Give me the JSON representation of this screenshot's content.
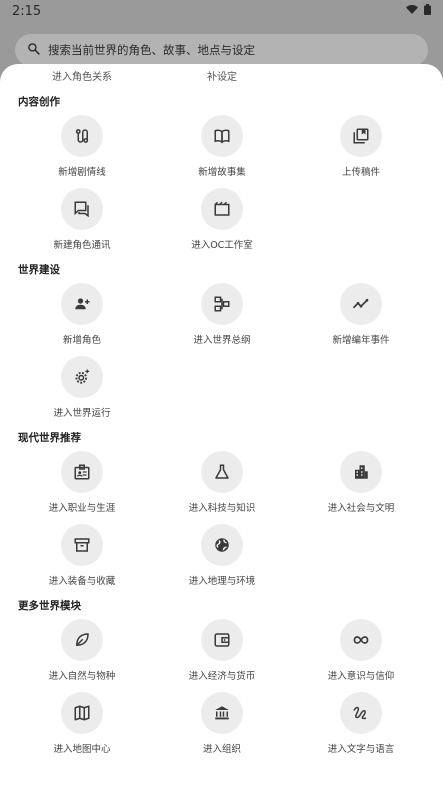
{
  "status": {
    "time": "2:15"
  },
  "search": {
    "placeholder": "搜索当前世界的角色、故事、地点与设定"
  },
  "top_partial": [
    "进入角色关系",
    "补设定"
  ],
  "sections": [
    {
      "title": "内容创作",
      "items": [
        {
          "label": "新增剧情线",
          "icon": "route-icon"
        },
        {
          "label": "新增故事集",
          "icon": "book-icon"
        },
        {
          "label": "上传稿件",
          "icon": "library-icon"
        },
        {
          "label": "新建角色通讯",
          "icon": "chat-icon"
        },
        {
          "label": "进入OC工作室",
          "icon": "clapperboard-icon"
        }
      ]
    },
    {
      "title": "世界建设",
      "items": [
        {
          "label": "新增角色",
          "icon": "person-add-icon"
        },
        {
          "label": "进入世界总纲",
          "icon": "hierarchy-icon"
        },
        {
          "label": "新增编年事件",
          "icon": "timeline-icon"
        },
        {
          "label": "进入世界运行",
          "icon": "settings-gear-icon"
        }
      ]
    },
    {
      "title": "现代世界推荐",
      "items": [
        {
          "label": "进入职业与生涯",
          "icon": "badge-icon"
        },
        {
          "label": "进入科技与知识",
          "icon": "flask-icon"
        },
        {
          "label": "进入社会与文明",
          "icon": "city-icon"
        },
        {
          "label": "进入装备与收藏",
          "icon": "archive-icon"
        },
        {
          "label": "进入地理与环境",
          "icon": "globe-icon"
        }
      ]
    },
    {
      "title": "更多世界模块",
      "items": [
        {
          "label": "进入自然与物种",
          "icon": "leaf-icon"
        },
        {
          "label": "进入经济与货币",
          "icon": "wallet-icon"
        },
        {
          "label": "进入意识与信仰",
          "icon": "infinity-icon"
        },
        {
          "label": "进入地图中心",
          "icon": "map-icon"
        },
        {
          "label": "进入组织",
          "icon": "institution-icon"
        },
        {
          "label": "进入文字与语言",
          "icon": "gesture-icon"
        }
      ]
    }
  ]
}
